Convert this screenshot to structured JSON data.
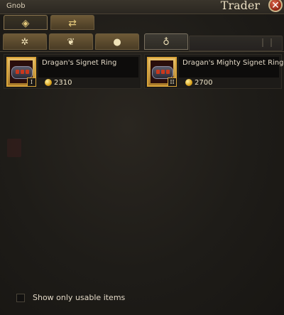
{
  "window": {
    "npc_name": "Gnob",
    "title": "Trader",
    "close_glyph": "✕"
  },
  "top_tabs": [
    {
      "name": "buy-tab",
      "icon": "coins-icon",
      "glyph": "◈",
      "active": true
    },
    {
      "name": "exchange-tab",
      "icon": "swap-arrows-icon",
      "glyph": "⇄",
      "active": false
    }
  ],
  "category_tabs": [
    {
      "icon": "amulet-icon",
      "glyph": "✲",
      "active": false
    },
    {
      "icon": "pendant-icon",
      "glyph": "❦",
      "active": false
    },
    {
      "icon": "pouch-icon",
      "glyph": "●",
      "active": false
    },
    {
      "icon": "ring-icon",
      "glyph": "♁",
      "active": true
    }
  ],
  "items": [
    {
      "name": "Dragan's Signet Ring",
      "price": "2310",
      "tier": "I"
    },
    {
      "name": "Dragan's Mighty Signet Ring",
      "price": "2700",
      "tier": "II"
    }
  ],
  "filter": {
    "label": "Show only usable items",
    "checked": false
  },
  "colors": {
    "gold_border": "#d9a43a",
    "panel_bg": "#1e1c18",
    "close_red": "#b83a22"
  }
}
